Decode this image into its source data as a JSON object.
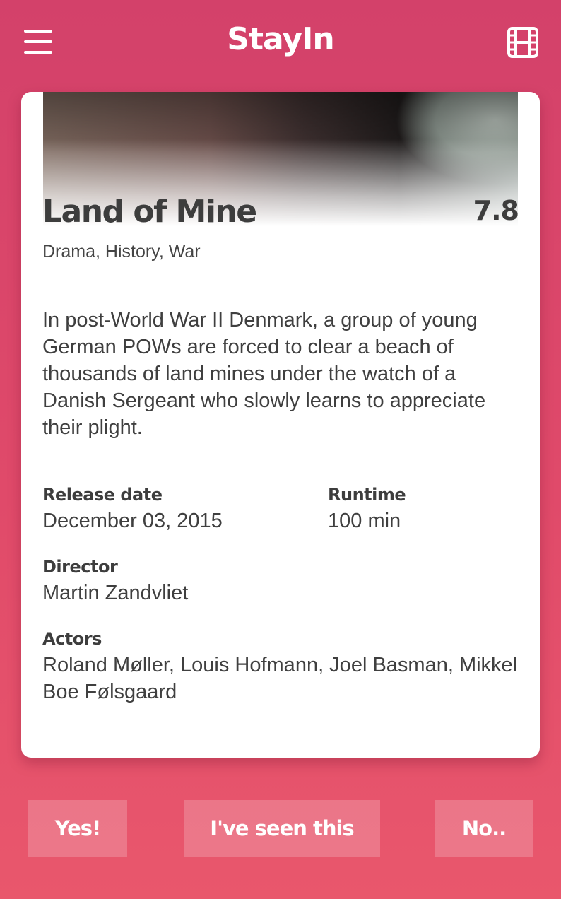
{
  "app": {
    "title": "StayIn"
  },
  "movie": {
    "title": "Land of Mine",
    "rating": "7.8",
    "genres": "Drama, History, War",
    "overview": "In post-World War II Denmark, a group of young German POWs are forced to clear a beach of thousands of land mines under the watch of a Danish Sergeant who slowly learns to appreciate their plight.",
    "release_date_label": "Release date",
    "release_date": "December 03, 2015",
    "runtime_label": "Runtime",
    "runtime": "100 min",
    "director_label": "Director",
    "director": "Martin Zandvliet",
    "actors_label": "Actors",
    "actors": "Roland Møller, Louis Hofmann, Joel Basman, Mikkel Boe Følsgaard"
  },
  "actions": {
    "yes_label": "Yes!",
    "seen_label": "I've seen this",
    "no_label": "No.."
  },
  "icons": {
    "menu": "hamburger-menu-icon",
    "film": "film-strip-icon"
  },
  "colors": {
    "background_top": "#d3416a",
    "background_bottom": "#e9576c",
    "text": "#3d3d3d",
    "card": "#ffffff"
  }
}
